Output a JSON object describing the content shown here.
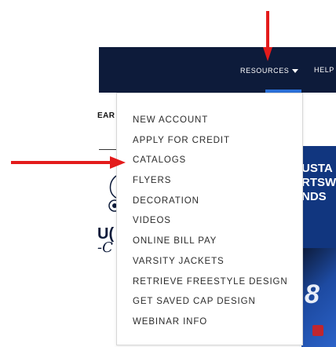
{
  "nav": {
    "resources_label": "RESOURCES",
    "help_label": "HELP"
  },
  "background": {
    "left_heading_fragment": "EAR",
    "left_big_fragment": "U(",
    "left_script_fragment": "-C",
    "promo_lines": [
      "USTA",
      "RTSW",
      "NDS"
    ],
    "promo_number": "8"
  },
  "dropdown": {
    "items": [
      "NEW ACCOUNT",
      "APPLY FOR CREDIT",
      "CATALOGS",
      "FLYERS",
      "DECORATION",
      "VIDEOS",
      "ONLINE BILL PAY",
      "VARSITY JACKETS",
      "RETRIEVE FREESTYLE DESIGN",
      "GET SAVED CAP DESIGN",
      "WEBINAR INFO"
    ]
  },
  "annotations": {
    "arrow_color": "#e31b1b",
    "arrow_down_icon": "arrow-down-icon",
    "arrow_right_icon": "arrow-right-icon"
  },
  "colors": {
    "navbar": "#0d1b3a",
    "menu_text": "#2b2b2b",
    "promo_blue": "#11367f"
  }
}
